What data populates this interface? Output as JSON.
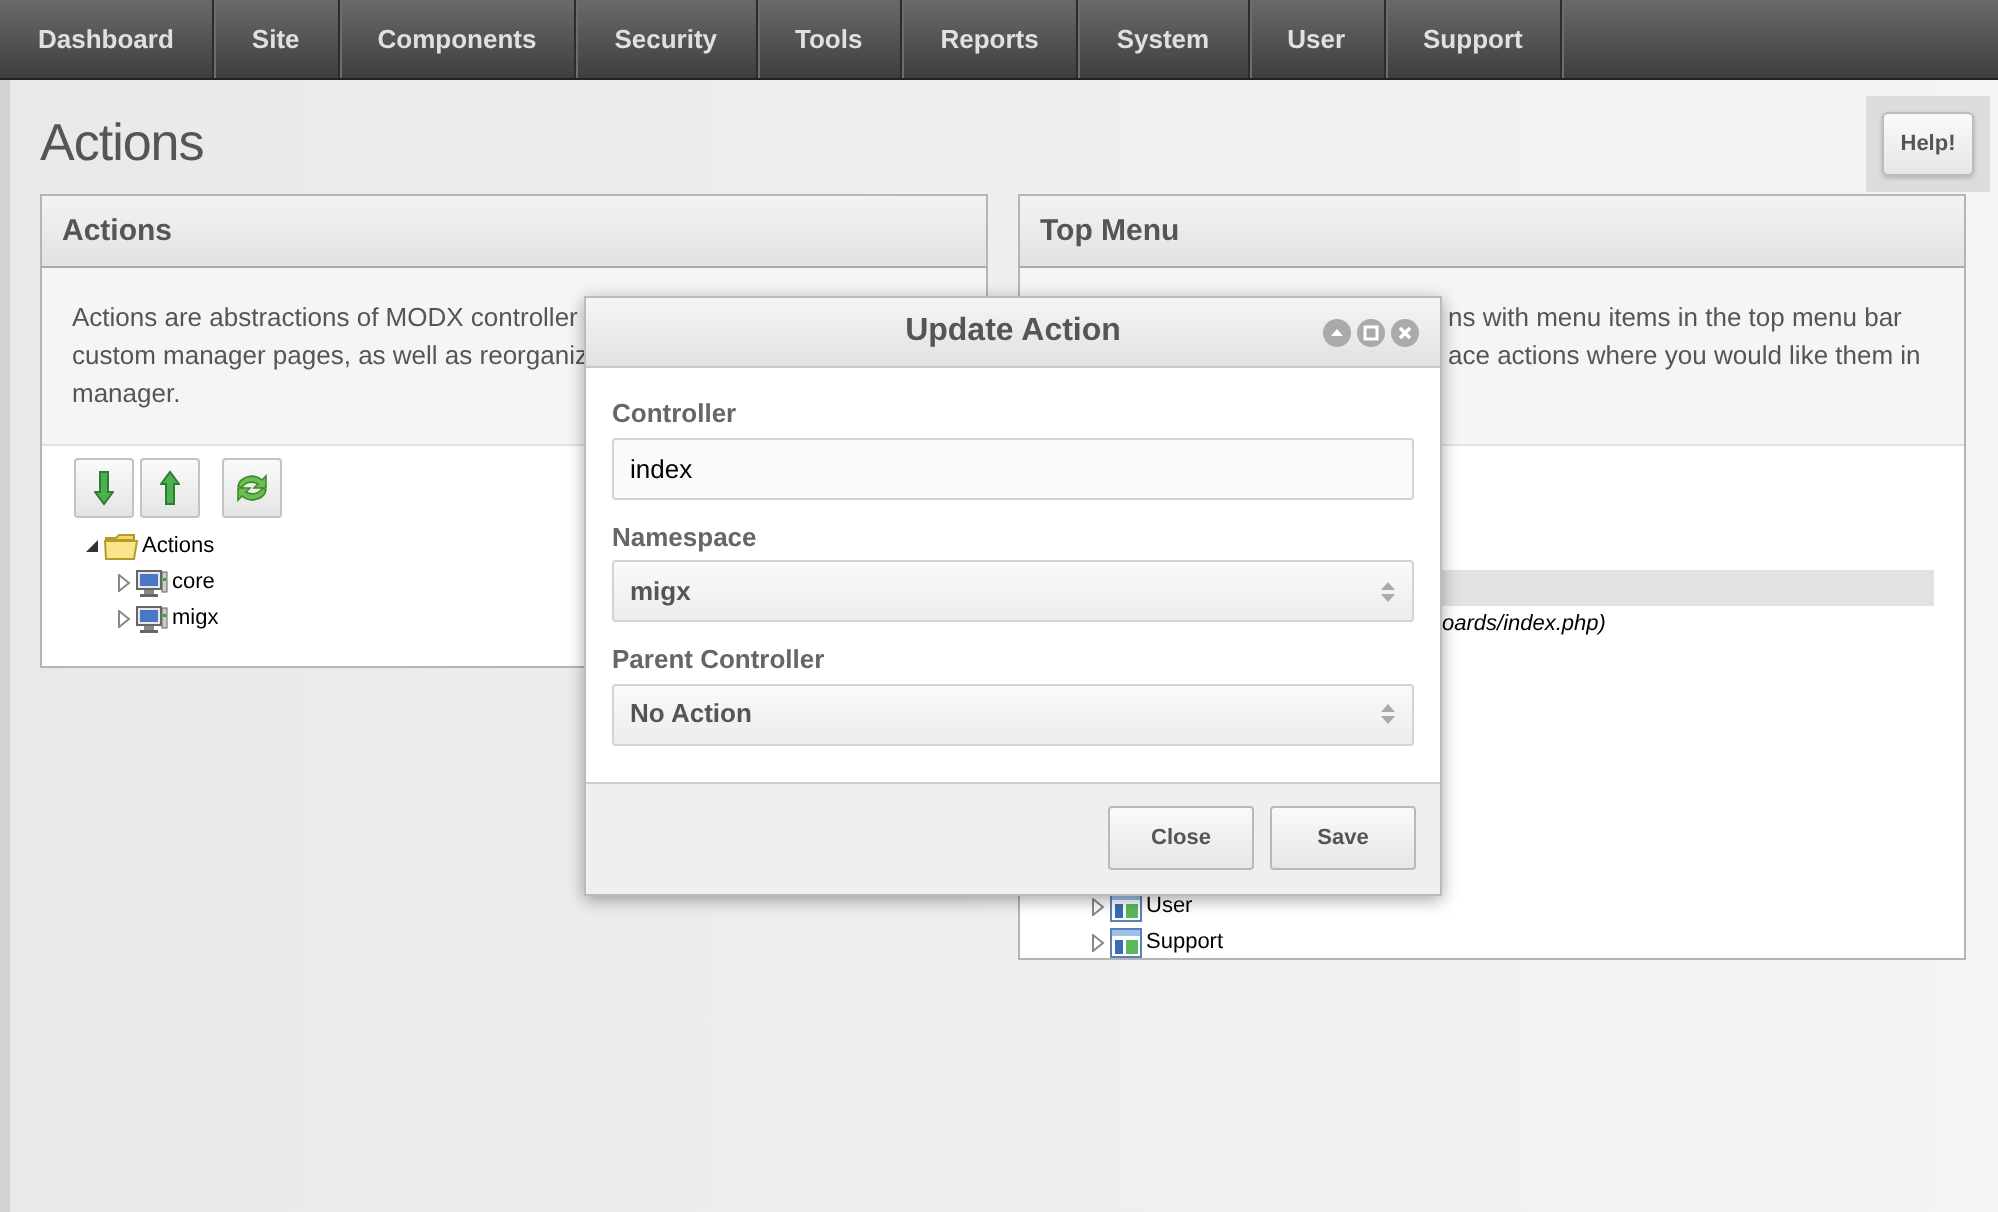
{
  "nav": [
    {
      "label": "Dashboard"
    },
    {
      "label": "Site"
    },
    {
      "label": "Components"
    },
    {
      "label": "Security"
    },
    {
      "label": "Tools"
    },
    {
      "label": "Reports"
    },
    {
      "label": "System"
    },
    {
      "label": "User"
    },
    {
      "label": "Support"
    }
  ],
  "page_title": "Actions",
  "help_button": "Help!",
  "actions_panel": {
    "title": "Actions",
    "description_lines": [
      "Actions are abstractions of MODX controller",
      "custom manager pages, as well as reorganiz",
      "manager."
    ],
    "toolbar": [
      {
        "kind": "down"
      },
      {
        "kind": "up"
      },
      {
        "kind": "refresh"
      }
    ],
    "tree": [
      {
        "label": "Actions",
        "kind": "folder",
        "expanded": true,
        "children": [
          {
            "label": "core",
            "kind": "namespace",
            "expanded": false
          },
          {
            "label": "migx",
            "kind": "namespace",
            "expanded": false
          }
        ]
      }
    ]
  },
  "top_menu_panel": {
    "title": "Top Menu",
    "description_lines": [
      "ns with menu items in the top menu bar",
      "ace actions where you would like them in"
    ],
    "tree_detail": "oards/index.php)",
    "tree": [
      {
        "label": "User",
        "kind": "menu",
        "expanded": false
      },
      {
        "label": "Support",
        "kind": "menu",
        "expanded": false
      }
    ]
  },
  "dialog": {
    "title": "Update Action",
    "fields": [
      {
        "kind": "text",
        "label": "Controller",
        "value": "index"
      },
      {
        "kind": "select",
        "label": "Namespace",
        "value": "migx"
      },
      {
        "kind": "select",
        "label": "Parent Controller",
        "value": "No Action"
      }
    ],
    "buttons": [
      "Close",
      "Save"
    ]
  }
}
